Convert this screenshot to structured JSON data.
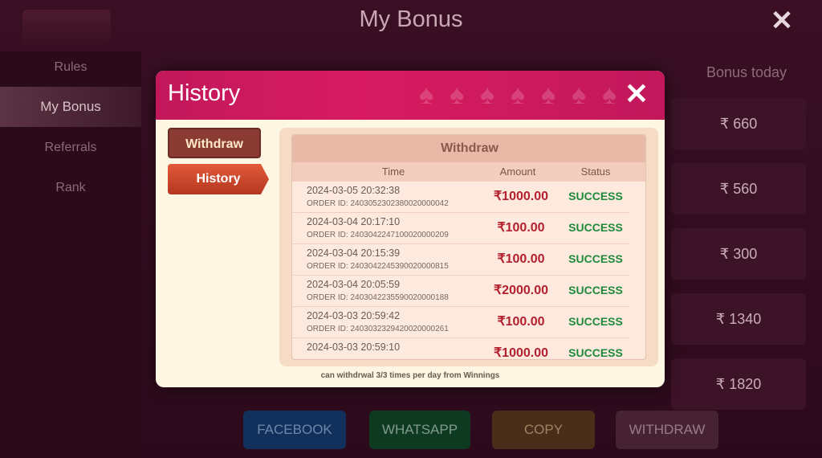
{
  "page": {
    "title": "My Bonus"
  },
  "sidebar": {
    "items": [
      {
        "label": "Rules"
      },
      {
        "label": "My Bonus"
      },
      {
        "label": "Referrals"
      },
      {
        "label": "Rank"
      }
    ]
  },
  "bonus_table": {
    "header": "Bonus today",
    "values": [
      "₹ 660",
      "₹ 560",
      "₹ 300",
      "₹ 1340",
      "₹ 1820"
    ]
  },
  "actions": {
    "facebook": "FACEBOOK",
    "whatsapp": "WHATSAPP",
    "copy": "COPY",
    "withdraw": "WITHDRAW"
  },
  "modal": {
    "title": "History",
    "tabs": {
      "withdraw": "Withdraw",
      "history": "History"
    },
    "panel_title": "Withdraw",
    "columns": {
      "time": "Time",
      "amount": "Amount",
      "status": "Status"
    },
    "rows": [
      {
        "time": "2024-03-05 20:32:38",
        "order": "ORDER ID: 2403052302380020000042",
        "amount": "₹1000.00",
        "status": "SUCCESS"
      },
      {
        "time": "2024-03-04 20:17:10",
        "order": "ORDER ID: 2403042247100020000209",
        "amount": "₹100.00",
        "status": "SUCCESS"
      },
      {
        "time": "2024-03-04 20:15:39",
        "order": "ORDER ID: 2403042245390020000815",
        "amount": "₹100.00",
        "status": "SUCCESS"
      },
      {
        "time": "2024-03-04 20:05:59",
        "order": "ORDER ID: 2403042235590020000188",
        "amount": "₹2000.00",
        "status": "SUCCESS"
      },
      {
        "time": "2024-03-03 20:59:42",
        "order": "ORDER ID: 2403032329420020000261",
        "amount": "₹100.00",
        "status": "SUCCESS"
      },
      {
        "time": "2024-03-03 20:59:10",
        "order": "",
        "amount": "₹1000.00",
        "status": "SUCCESS"
      }
    ],
    "note": "can withdrwal 3/3 times per day from Winnings"
  }
}
